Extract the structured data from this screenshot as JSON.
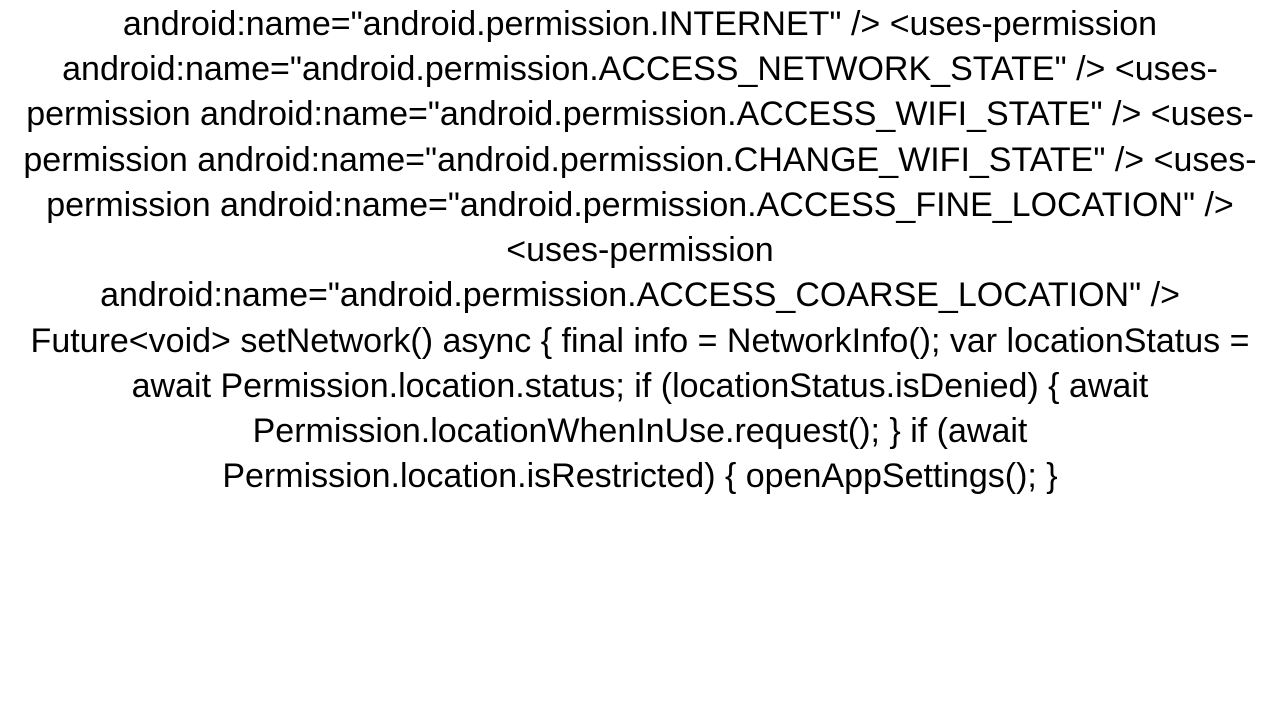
{
  "code": "android:name=\"android.permission.INTERNET\" /> <uses-permission android:name=\"android.permission.ACCESS_NETWORK_STATE\" /> <uses-permission android:name=\"android.permission.ACCESS_WIFI_STATE\" /> <uses-permission android:name=\"android.permission.CHANGE_WIFI_STATE\" /> <uses-permission android:name=\"android.permission.ACCESS_FINE_LOCATION\" /> <uses-permission android:name=\"android.permission.ACCESS_COARSE_LOCATION\" /> Future<void> setNetwork() async { final info = NetworkInfo(); var locationStatus = await Permission.location.status; if (locationStatus.isDenied) { await Permission.locationWhenInUse.request(); } if (await Permission.location.isRestricted) {   openAppSettings(); }"
}
